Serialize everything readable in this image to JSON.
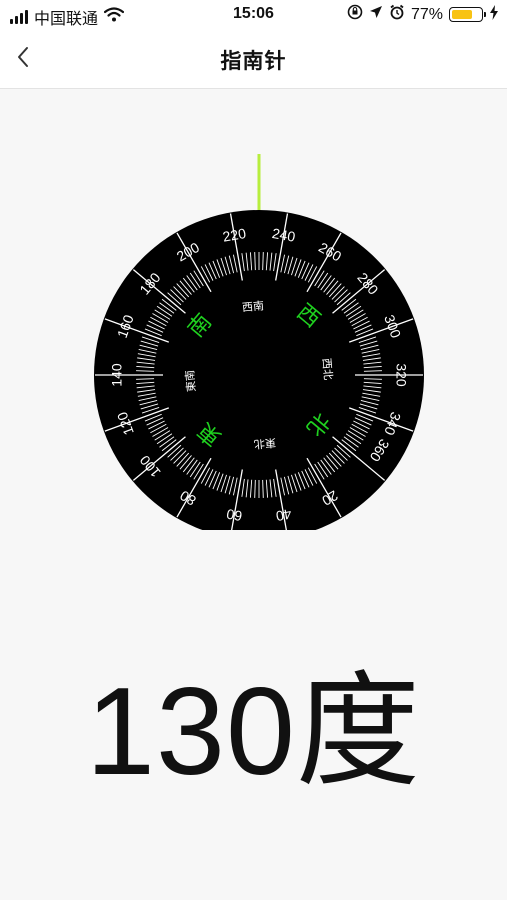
{
  "status_bar": {
    "carrier": "中国联通",
    "time": "15:06",
    "battery_percent_text": "77%",
    "battery_level": 0.77,
    "icons": [
      "signal-icon",
      "wifi-icon",
      "orientation-lock-icon",
      "location-icon",
      "alarm-icon",
      "battery-icon",
      "charging-icon"
    ]
  },
  "nav": {
    "title": "指南针",
    "back_icon": "chevron-left-icon"
  },
  "compass": {
    "heading_degrees": 130,
    "tick_labels": [
      "0",
      "20",
      "40",
      "60",
      "80",
      "100",
      "120",
      "140",
      "160",
      "180",
      "200",
      "220",
      "240",
      "260",
      "280",
      "300",
      "320",
      "340",
      "360"
    ],
    "cardinals": {
      "north": "北",
      "south": "南",
      "east": "東",
      "west": "西"
    },
    "intercardinals": {
      "southwest": "西南",
      "northwest": "西北",
      "northeast": "東北",
      "southeast": "東南"
    },
    "colors": {
      "dial": "#000000",
      "ticks": "#ffffff",
      "cardinal": "#1fd11f",
      "needle": "#b7ee3e",
      "background": "#f7f7f7"
    }
  },
  "readout": {
    "text": "130度"
  }
}
